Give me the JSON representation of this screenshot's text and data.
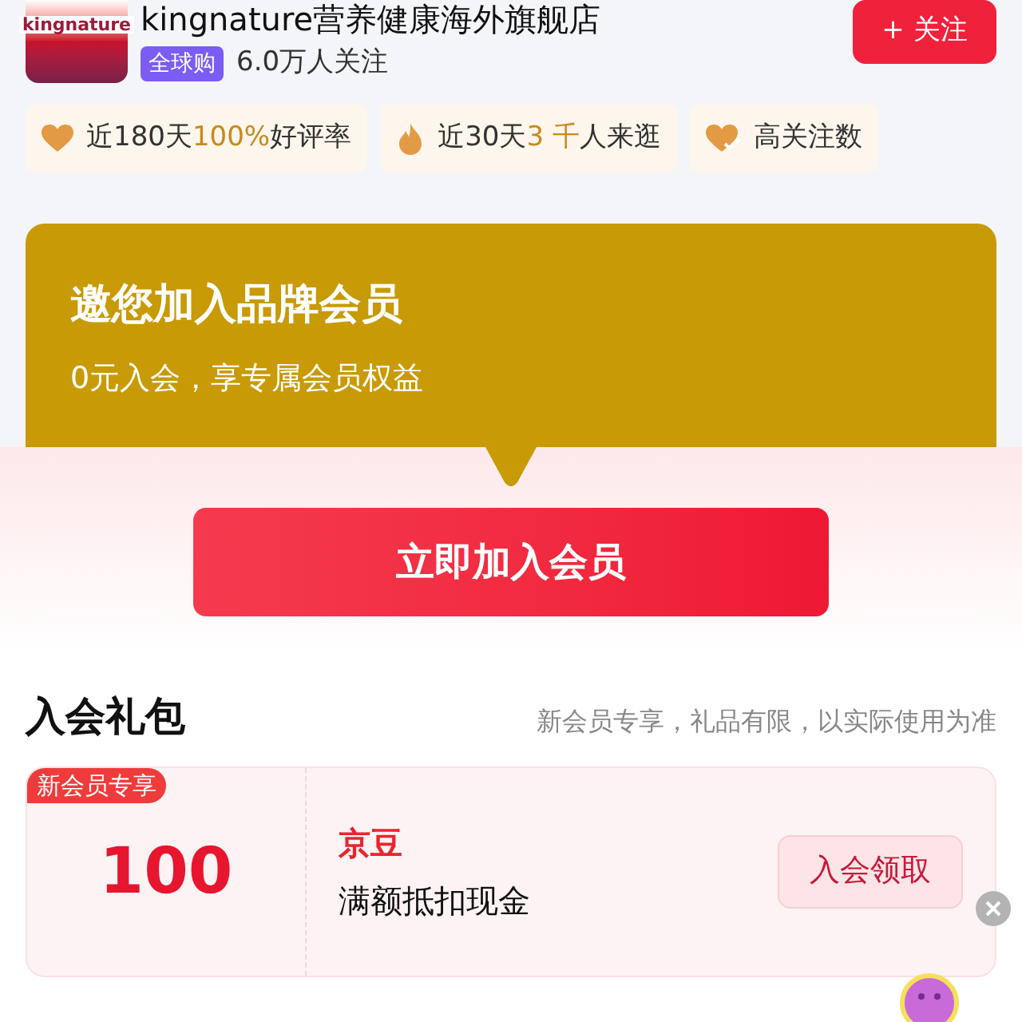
{
  "shop": {
    "logo_text": "kingnature",
    "name": "kingnature营养健康海外旗舰店",
    "badge": "全球购",
    "followers": "6.0万人关注",
    "follow_button": "+ 关注"
  },
  "highlights": [
    {
      "kind": "heart",
      "before": "近180天",
      "accent": "100%",
      "after": "好评率"
    },
    {
      "kind": "flame",
      "before": "近30天",
      "accent": "3 千",
      "after": "人来逛"
    },
    {
      "kind": "heart-check",
      "after": "高关注数"
    }
  ],
  "invite": {
    "title": "邀您加入品牌会员",
    "subtitle": "0元入会，享专属会员权益",
    "join_button": "立即加入会员"
  },
  "gift": {
    "title": "入会礼包",
    "note": "新会员专享，礼品有限，以实际使用为准",
    "items": [
      {
        "tag": "新会员专享",
        "amount": "100",
        "name": "京豆",
        "description": "满额抵扣现金",
        "button": "入会领取"
      }
    ]
  }
}
